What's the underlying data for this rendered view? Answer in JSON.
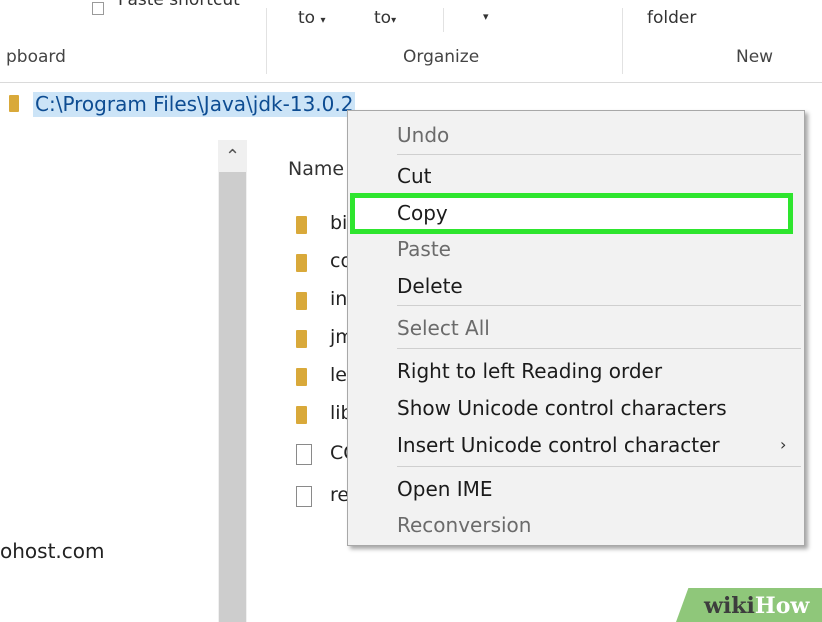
{
  "ribbon": {
    "clipboard_label": "pboard",
    "paste_shortcut": "Paste shortcut",
    "move_to": "to",
    "copy_to": "to",
    "organize_label": "Organize",
    "new_folder": "folder",
    "new_label": "New"
  },
  "address": {
    "path": "C:\\Program Files\\Java\\jdk-13.0.2"
  },
  "nav": {
    "host_item": "ohost.com"
  },
  "file_list": {
    "column_name": "Name",
    "items": [
      {
        "name": "bi",
        "type": "folder"
      },
      {
        "name": "co",
        "type": "folder"
      },
      {
        "name": "in",
        "type": "folder"
      },
      {
        "name": "jm",
        "type": "folder"
      },
      {
        "name": "le",
        "type": "folder"
      },
      {
        "name": "lib",
        "type": "folder"
      },
      {
        "name": "CO",
        "type": "file"
      },
      {
        "name": "re",
        "type": "file"
      }
    ]
  },
  "context_menu": {
    "items": [
      {
        "label": "Undo",
        "enabled": false
      },
      {
        "label": "Cut",
        "enabled": true
      },
      {
        "label": "Copy",
        "enabled": true,
        "highlighted": true
      },
      {
        "label": "Paste",
        "enabled": false
      },
      {
        "label": "Delete",
        "enabled": true
      },
      {
        "label": "Select All",
        "enabled": false
      },
      {
        "label": "Right to left Reading order",
        "enabled": true
      },
      {
        "label": "Show Unicode control characters",
        "enabled": true
      },
      {
        "label": "Insert Unicode control character",
        "enabled": true,
        "submenu": true
      },
      {
        "label": "Open IME",
        "enabled": true
      },
      {
        "label": "Reconversion",
        "enabled": false
      }
    ],
    "highlight_color": "#2ee52e"
  },
  "watermark": {
    "part1": "wiki",
    "part2": "How"
  },
  "colors": {
    "selection_bg": "#cce4f7",
    "selection_text": "#0d4c92",
    "folder": "#d9a93a"
  }
}
